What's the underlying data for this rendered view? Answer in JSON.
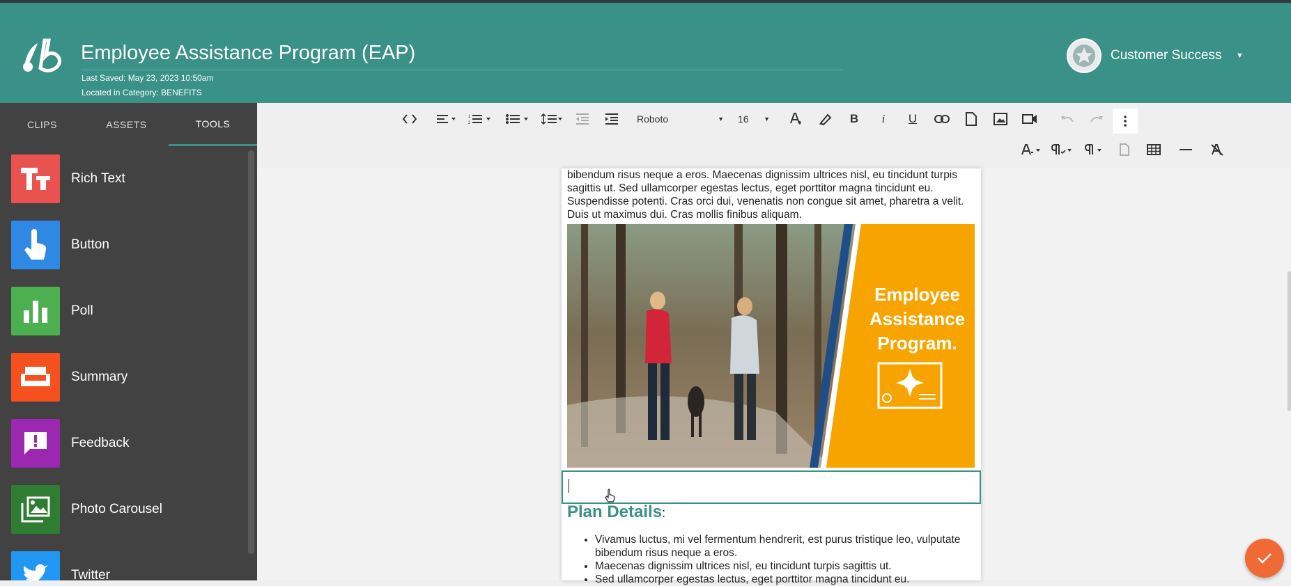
{
  "header": {
    "title": "Employee Assistance Program (EAP)",
    "last_saved": "Last Saved: May 23, 2023 10:50am",
    "category": "Located in Category: BENEFITS",
    "user": "Customer Success"
  },
  "sidebar": {
    "tabs": [
      "CLIPS",
      "ASSETS",
      "TOOLS"
    ],
    "active_tab": "TOOLS",
    "tools": [
      {
        "label": "Rich Text",
        "icon": "text-format-icon",
        "color": "#e9534f"
      },
      {
        "label": "Button",
        "icon": "touch-icon",
        "color": "#2f88e3"
      },
      {
        "label": "Poll",
        "icon": "bar-chart-icon",
        "color": "#4caf50"
      },
      {
        "label": "Summary",
        "icon": "sofa-icon",
        "color": "#f4511e"
      },
      {
        "label": "Feedback",
        "icon": "feedback-icon",
        "color": "#9c27b0"
      },
      {
        "label": "Photo Carousel",
        "icon": "photo-library-icon",
        "color": "#2e7d32"
      },
      {
        "label": "Twitter",
        "icon": "twitter-icon",
        "color": "#2196f3"
      }
    ]
  },
  "toolbar": {
    "font": "Roboto",
    "size": "16"
  },
  "content": {
    "lorem": "bibendum risus neque a eros. Maecenas dignissim ultrices nisl, eu tincidunt turpis sagittis ut. Sed ullamcorper egestas lectus, eget porttitor magna tincidunt eu. Suspendisse potenti. Cras orci dui, venenatis non congue sit amet, pharetra a velit. Duis ut maximus dui. Cras mollis finibus aliquam.",
    "banner_text": "Employee Assistance Program.",
    "plan_title": "Plan Details",
    "plan_colon": ":",
    "bullets": [
      "Vivamus luctus, mi vel fermentum hendrerit, est purus tristique leo, vulputate bibendum risus neque a eros.",
      "Maecenas dignissim ultrices nisl, eu tincidunt turpis sagittis ut.",
      "Sed ullamcorper egestas lectus, eget porttitor magna tincidunt eu."
    ]
  },
  "colors": {
    "brand": "#3a9187",
    "banner": "#f7a400",
    "fab": "#f06a35"
  }
}
